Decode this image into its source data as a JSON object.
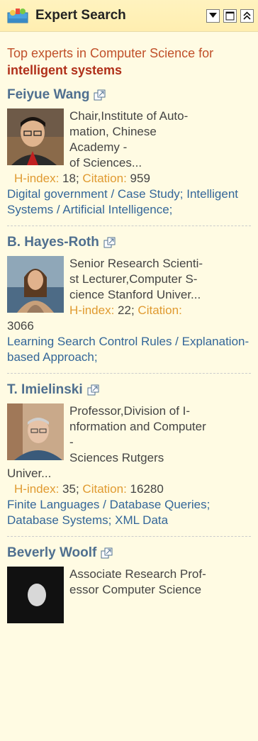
{
  "header": {
    "title": "Expert Search",
    "icon": "expert-search-icon",
    "buttons": [
      "dropdown-icon",
      "maximize-icon",
      "collapse-icon"
    ]
  },
  "intro": {
    "prefix": "Top experts in Computer Science for ",
    "query": "intelligent systems"
  },
  "experts": [
    {
      "name": "Feiyue Wang",
      "bio_lines": [
        "Chair,Institute of Auto-",
        "mation, Chinese",
        "Academy -",
        "of Sciences..."
      ],
      "hindex_label": "H-index:",
      "hindex": "18;",
      "citation_label": "Citation:",
      "citation": "959",
      "topics": "Digital government / Case Study; Intelligent Systems / Artificial Intelligence;"
    },
    {
      "name": "B. Hayes-Roth",
      "bio_lines": [
        "Senior Research Scienti-",
        "st  Lecturer,Computer S-",
        "cience Stanford Univer..."
      ],
      "hindex_label": "H-index:",
      "hindex": "22;",
      "citation_label": "Citation:",
      "citation": "3066",
      "topics": "Learning Search Control Rules / Explanation-based Approach;"
    },
    {
      "name": "T. Imielinski",
      "bio_lines": [
        "Professor,Division of I-",
        "nformation and Computer",
        "-",
        "Sciences Rutgers",
        "Univer..."
      ],
      "hindex_label": "H-index:",
      "hindex": "35;",
      "citation_label": "Citation:",
      "citation": "16280",
      "topics": "Finite Languages / Database Queries; Database Systems; XML Data"
    },
    {
      "name": "Beverly Woolf",
      "bio_lines": [
        "Associate Research Prof-",
        "essor Computer Science"
      ]
    }
  ]
}
